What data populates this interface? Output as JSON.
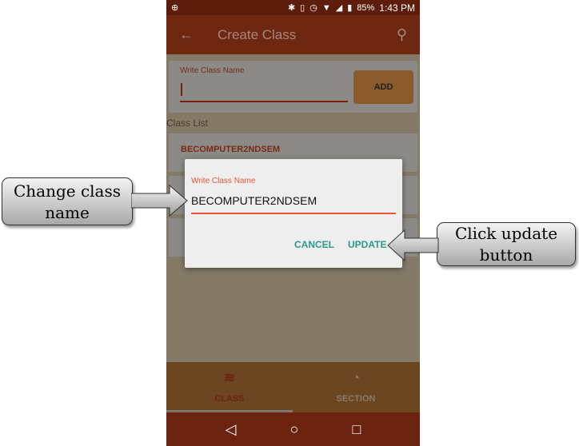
{
  "status_bar": {
    "battery": "85%",
    "time": "1:43 PM",
    "icons": [
      "app-icon",
      "bluetooth-icon",
      "vibrate-icon",
      "alarm-icon",
      "wifi-icon",
      "signal-icon",
      "battery-icon"
    ]
  },
  "toolbar": {
    "title": "Create Class",
    "back_icon": "arrow-left-icon",
    "search_icon": "search-icon"
  },
  "add_form": {
    "label": "Write Class Name",
    "value": "",
    "button": "ADD"
  },
  "class_list": {
    "label": "Class List",
    "items": [
      "BECOMPUTER2NDSEM"
    ]
  },
  "dialog": {
    "label": "Write Class Name",
    "value": "BECOMPUTER2NDSEM",
    "cancel": "CANCEL",
    "update": "UPDATE"
  },
  "bottom_nav": {
    "tabs": [
      {
        "label": "CLASS",
        "icon": "layers-icon",
        "active": true
      },
      {
        "label": "SECTION",
        "icon": "pie-chart-icon",
        "active": false
      }
    ]
  },
  "callouts": {
    "left": "Change class name",
    "right": "Click update button"
  },
  "colors": {
    "toolbar": "#6e2812",
    "accent": "#e8553a",
    "dialog_button": "#2a9a8a"
  }
}
